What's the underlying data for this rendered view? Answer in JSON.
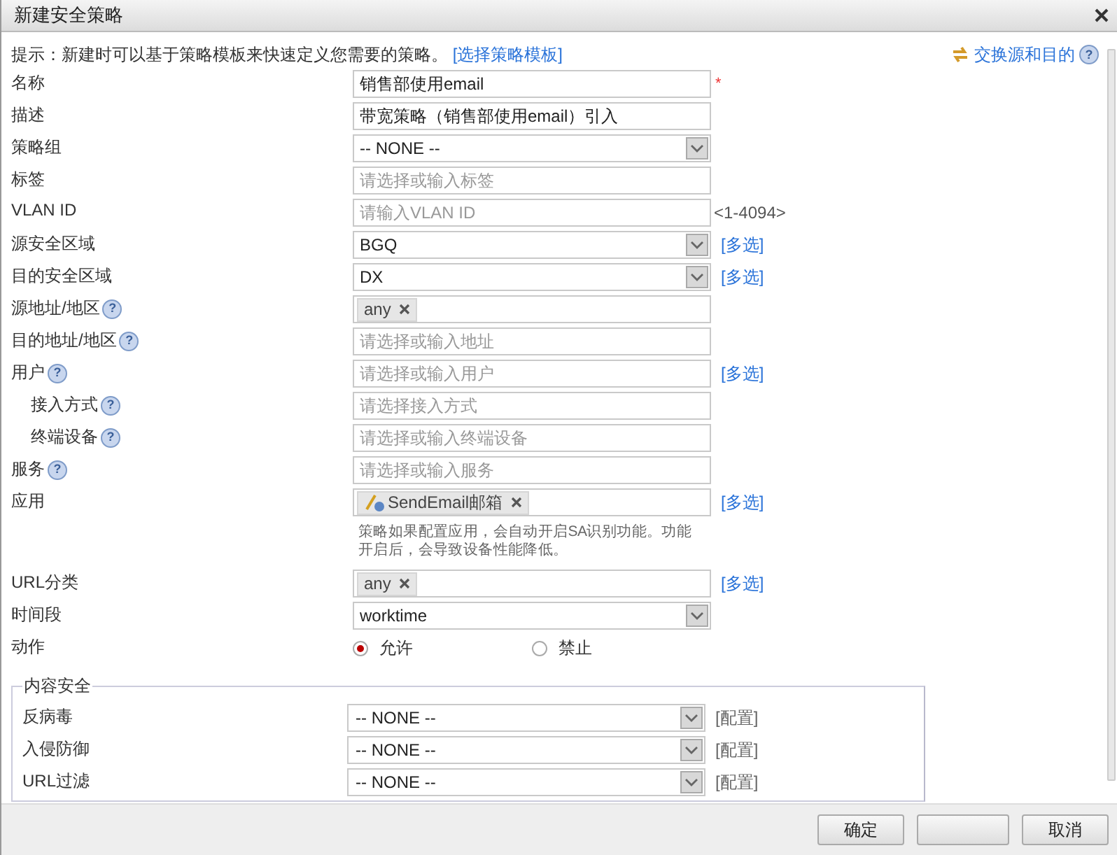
{
  "window": {
    "title": "新建安全策略"
  },
  "hint": {
    "text": "提示：新建时可以基于策略模板来快速定义您需要的策略。",
    "link": "[选择策略模板]"
  },
  "swap_link": {
    "text": "交换源和目的",
    "help": "?"
  },
  "fields": [
    {
      "label": "名称",
      "kind": "text",
      "value": "销售部使用email",
      "required": "*"
    },
    {
      "label": "描述",
      "kind": "text",
      "value": "带宽策略（销售部使用email）引入"
    },
    {
      "label": "策略组",
      "kind": "select",
      "value": "-- NONE --"
    },
    {
      "label": "标签",
      "kind": "text",
      "placeholder": "请选择或输入标签"
    },
    {
      "label": "VLAN ID",
      "kind": "text",
      "placeholder": "请输入VLAN ID",
      "note": "<1-4094>"
    },
    {
      "label": "源安全区域",
      "kind": "select",
      "value": "BGQ",
      "link": "[多选]"
    },
    {
      "label": "目的安全区域",
      "kind": "select",
      "value": "DX",
      "link": "[多选]"
    },
    {
      "label": "源地址/地区",
      "kind": "tags",
      "tags": [
        {
          "text": "any",
          "icon": false
        }
      ],
      "help": "?"
    },
    {
      "label": "目的地址/地区",
      "kind": "text",
      "placeholder": "请选择或输入地址",
      "help": "?"
    },
    {
      "label": "用户",
      "kind": "text",
      "placeholder": "请选择或输入用户",
      "link": "[多选]",
      "help": "?",
      "children": [
        {
          "label": "接入方式",
          "kind": "text",
          "placeholder": "请选择接入方式",
          "help": "?"
        },
        {
          "label": "终端设备",
          "kind": "text",
          "placeholder": "请选择或输入终端设备",
          "help": "?"
        }
      ]
    },
    {
      "label": "服务",
      "kind": "text",
      "placeholder": "请选择或输入服务",
      "help": "?"
    },
    {
      "label": "应用",
      "kind": "tags",
      "tags": [
        {
          "text": "SendEmail邮箱",
          "icon": true
        }
      ],
      "link": "[多选]",
      "description": "策略如果配置应用，会自动开启SA识别功能。功能开启后，会导致设备性能降低。"
    },
    {
      "label": "URL分类",
      "kind": "tags",
      "tags": [
        {
          "text": "any",
          "icon": false
        }
      ],
      "link": "[多选]"
    },
    {
      "label": "时间段",
      "kind": "select",
      "value": "worktime"
    },
    {
      "label": "动作",
      "kind": "radio",
      "options": [
        {
          "text": "允许",
          "selected": true
        },
        {
          "text": "禁止",
          "selected": false
        }
      ]
    }
  ],
  "content_security": {
    "title": "内容安全",
    "rows": [
      {
        "label": "反病毒",
        "value": "-- NONE --",
        "link": "[配置]"
      },
      {
        "label": "入侵防御",
        "value": "-- NONE --",
        "link": "[配置]"
      },
      {
        "label": "URL过滤",
        "value": "-- NONE --",
        "link": "[配置]"
      }
    ]
  },
  "footer": {
    "buttons": [
      {
        "kind": "labeled",
        "label": "确定"
      },
      {
        "kind": "obscured"
      },
      {
        "kind": "labeled",
        "label": "取消"
      }
    ]
  }
}
